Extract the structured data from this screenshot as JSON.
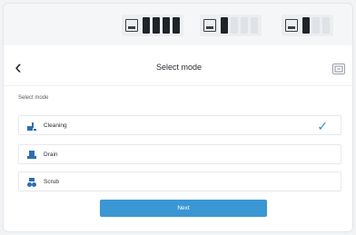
{
  "header": {
    "title": "Select mode",
    "back_icon": "chevron-left-icon",
    "right_icon": "robot-status-icon"
  },
  "status_strip": {
    "gauges": [
      {
        "icon": "battery-icon",
        "level": 4,
        "segments": 4
      },
      {
        "icon": "clean-water-tank-icon",
        "level": 1,
        "segments": 4
      },
      {
        "icon": "dirty-water-tank-icon",
        "level": 1,
        "segments": 3
      }
    ]
  },
  "section": {
    "label": "Select mode"
  },
  "options": [
    {
      "label": "Cleaning",
      "icon": "cleaning-icon",
      "selected": true
    },
    {
      "label": "Drain",
      "icon": "drain-icon",
      "selected": false
    },
    {
      "label": "Scrub",
      "icon": "scrub-icon",
      "selected": false
    }
  ],
  "cta": {
    "label": "Next"
  },
  "colors": {
    "accent": "#3a97d4",
    "check": "#3b8fd6",
    "text": "#2a2d33"
  }
}
